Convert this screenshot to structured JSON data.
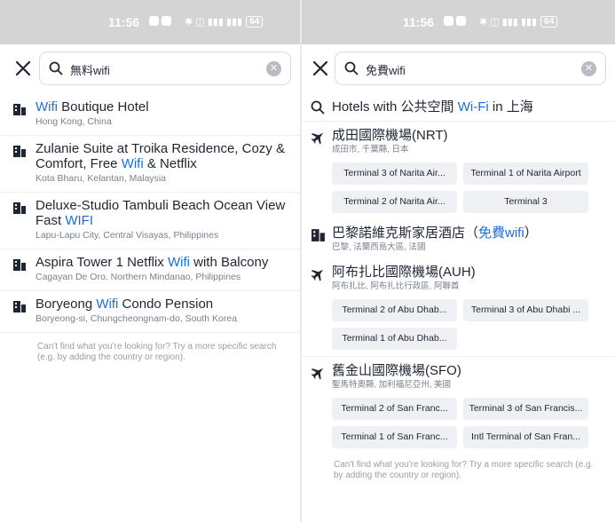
{
  "status_bar": {
    "time": "11:56",
    "battery": "64"
  },
  "left": {
    "search": {
      "value": "無料wifi"
    },
    "results": [
      {
        "pre": "",
        "hl": "Wifi",
        "post": " Boutique Hotel",
        "sub": "Hong Kong, China"
      },
      {
        "pre": "Zulanie Suite at Troika Residence, Cozy & Comfort, Free ",
        "hl": "Wifi",
        "post": " & Netflix",
        "sub": "Kota Bharu, Kelantan, Malaysia"
      },
      {
        "pre": "Deluxe-Studio Tambuli Beach Ocean View Fast ",
        "hl": "WIFI",
        "post": "",
        "sub": "Lapu-Lapu City, Central Visayas, Philippines"
      },
      {
        "pre": "Aspira Tower 1 Netflix ",
        "hl": "Wifi",
        "post": " with Balcony",
        "sub": "Cagayan De Oro, Northern Mindanao, Philippines"
      },
      {
        "pre": "Boryeong ",
        "hl": "Wifi",
        "post": " Condo Pension",
        "sub": "Boryeong-si, Chungcheongnam-do, South Korea"
      }
    ],
    "footer_note": "Can't find what you're looking for? Try a more specific search (e.g. by adding the country or region)."
  },
  "right": {
    "search": {
      "value": "免費wifi"
    },
    "suggestion": {
      "pre": "Hotels with 公共空間 ",
      "hl": "Wi-Fi",
      "post": " in 上海"
    },
    "nrt": {
      "title": "成田國際機場(NRT)",
      "sub": "成田市, 千葉縣, 日本",
      "chips": [
        "Terminal 3 of Narita Air...",
        "Terminal 1 of Narita Airport",
        "Terminal 2 of Narita Air...",
        "Terminal 3"
      ]
    },
    "hotel": {
      "pre": "巴黎諾維克斯家居酒店（",
      "hl": "免費wifi",
      "post": "）",
      "sub": "巴黎, 法蘭西島大區, 法國"
    },
    "auh": {
      "title": "阿布扎比國際機場(AUH)",
      "sub": "阿布扎比, 阿布扎比行政區, 阿聯酋",
      "chips": [
        "Terminal 2 of Abu Dhab...",
        "Terminal 3 of Abu Dhabi ...",
        "Terminal 1 of Abu Dhab..."
      ]
    },
    "sfo": {
      "title": "舊金山國際機場(SFO)",
      "sub": "聖馬特奧縣, 加利福尼亞州, 美國",
      "chips": [
        "Terminal 2 of San Franc...",
        "Terminal 3 of San Francis...",
        "Terminal 1 of San Franc...",
        "Intl Terminal of San Fran..."
      ]
    },
    "footer_note": "Can't find what you're looking for? Try a more specific search (e.g. by adding the country or region)."
  },
  "colors": {
    "highlight": "#1a6dde",
    "status_bar": "#d4d4d4",
    "chip_bg": "#eef0f3"
  },
  "icons": {
    "close": "close-icon",
    "search": "search-icon",
    "clear": "clear-icon",
    "hotel": "building-icon",
    "airport": "airplane-icon"
  }
}
